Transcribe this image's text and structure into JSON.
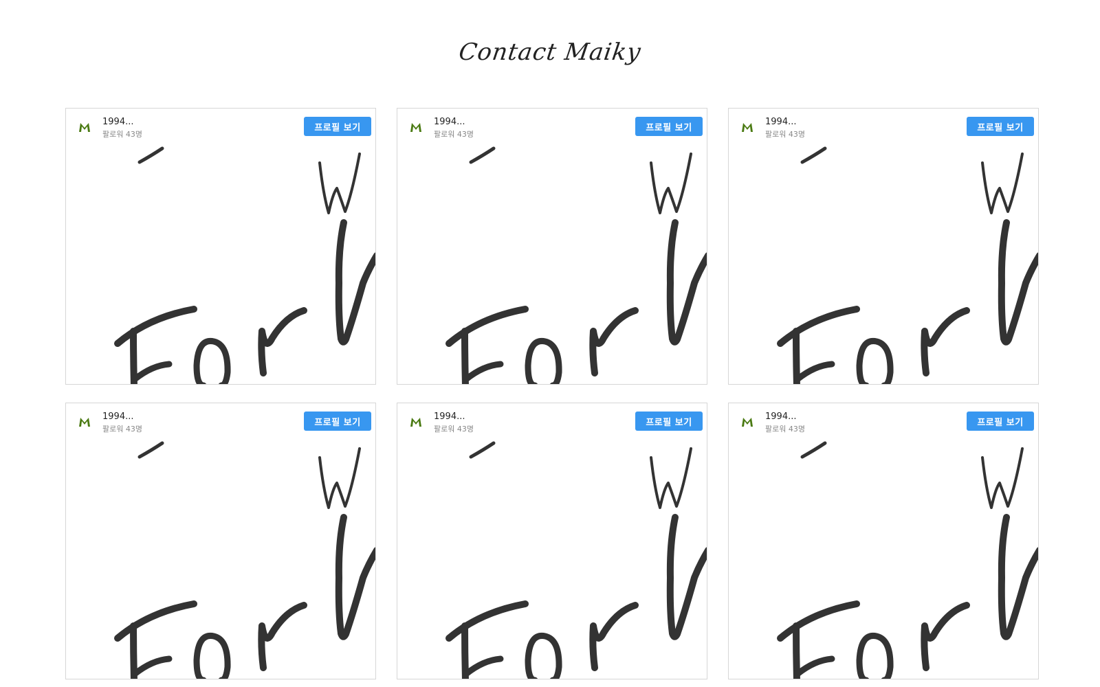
{
  "page": {
    "title": "Contact Maiky"
  },
  "cards": [
    {
      "name": "1994...",
      "followers": "팔로워 43명",
      "button_label": "프로필 보기",
      "avatar_letter": "M"
    },
    {
      "name": "1994...",
      "followers": "팔로워 43명",
      "button_label": "프로필 보기",
      "avatar_letter": "M"
    },
    {
      "name": "1994...",
      "followers": "팔로워 43명",
      "button_label": "프로필 보기",
      "avatar_letter": "M"
    },
    {
      "name": "1994...",
      "followers": "팔로워 43명",
      "button_label": "프로필 보기",
      "avatar_letter": "M"
    },
    {
      "name": "1994...",
      "followers": "팔로워 43명",
      "button_label": "프로필 보기",
      "avatar_letter": "M"
    },
    {
      "name": "1994...",
      "followers": "팔로워 43명",
      "button_label": "프로필 보기",
      "avatar_letter": "M"
    }
  ],
  "colors": {
    "button": "#3897f0",
    "avatar": "#4a7a12",
    "handwriting": "#333333"
  }
}
